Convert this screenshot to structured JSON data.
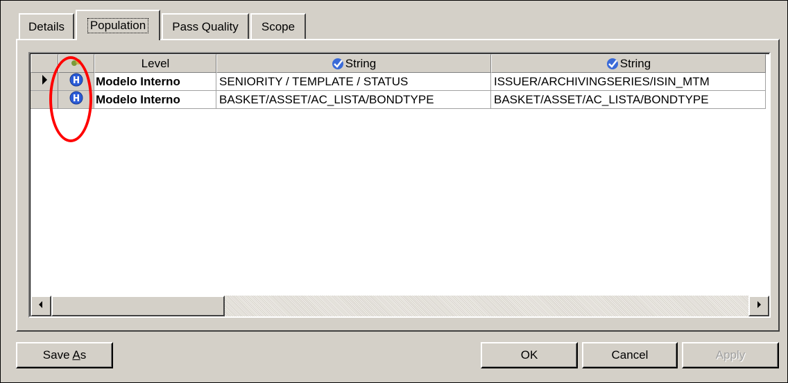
{
  "tabs": [
    {
      "label": "Details"
    },
    {
      "label": "Population",
      "active": true
    },
    {
      "label": "Pass Quality"
    },
    {
      "label": "Scope"
    }
  ],
  "grid": {
    "columns": [
      {
        "label": ""
      },
      {
        "label": ""
      },
      {
        "label": "Level"
      },
      {
        "label": "String",
        "icon": "check-icon"
      },
      {
        "label": "String",
        "icon": "check-icon"
      }
    ],
    "rows": [
      {
        "current": true,
        "icon": "info-icon",
        "level": "Modelo Interno",
        "col1": "SENIORITY / TEMPLATE / STATUS",
        "col2": "ISSUER/ARCHIVINGSERIES/ISIN_MTM"
      },
      {
        "current": false,
        "icon": "info-icon",
        "level": "Modelo Interno",
        "col1": "BASKET/ASSET/AC_LISTA/BONDTYPE",
        "col2": "BASKET/ASSET/AC_LISTA/BONDTYPE"
      }
    ]
  },
  "buttons": {
    "save_as_prefix": "Save ",
    "save_as_mnemonic": "A",
    "save_as_suffix": "s",
    "ok": "OK",
    "cancel": "Cancel",
    "apply": "Apply"
  },
  "colors": {
    "face": "#d4d0c8",
    "highlight_circle": "#ff0000",
    "icon_blue": "#2a5bd7"
  }
}
